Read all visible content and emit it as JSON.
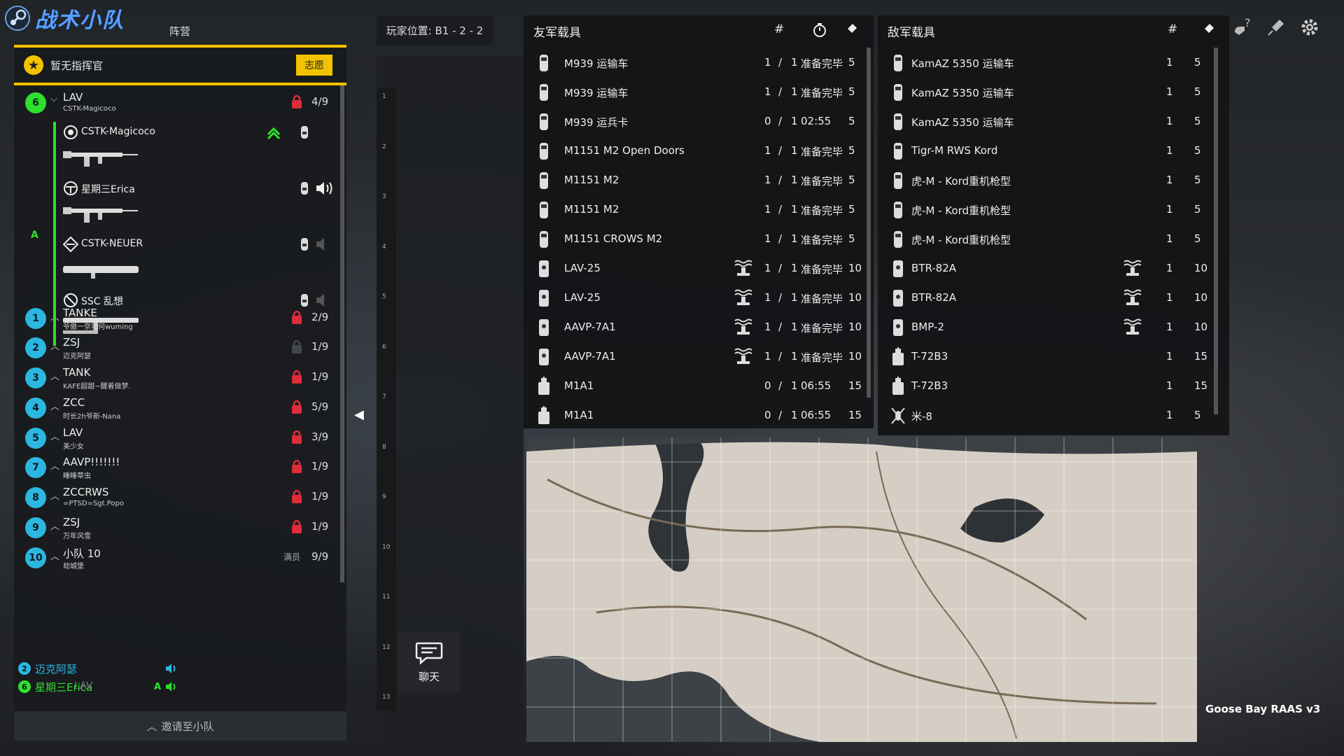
{
  "header": {
    "logo_text": "战术小队",
    "camp_label": "阵营",
    "player_location": "玩家位置: B1 - 2 - 2"
  },
  "commander": {
    "label": "暂无指挥官",
    "volunteer_button": "志愿"
  },
  "squads": [
    {
      "num": "6",
      "name": "LAV",
      "leader": "CSTK-Magicoco",
      "count": "4/9",
      "locked": true,
      "expanded": true,
      "color": "#2ee02e"
    },
    {
      "num": "1",
      "name": "TANKE",
      "leader": "爷傲一奈我何wuming",
      "count": "2/9",
      "locked": true
    },
    {
      "num": "2",
      "name": "ZSJ",
      "leader": "迈克阿瑟",
      "count": "1/9",
      "locked": false
    },
    {
      "num": "3",
      "name": "TANK",
      "leader": "KAFE超甜~醒着做梦.",
      "count": "1/9",
      "locked": true
    },
    {
      "num": "4",
      "name": "ZCC",
      "leader": "时长2h爷新-Nana",
      "count": "5/9",
      "locked": true
    },
    {
      "num": "5",
      "name": "LAV",
      "leader": "美少女",
      "count": "3/9",
      "locked": true
    },
    {
      "num": "7",
      "name": "AAVP!!!!!!!",
      "leader": "睡睡草虫",
      "count": "1/9",
      "locked": true
    },
    {
      "num": "8",
      "name": "ZCCRWS",
      "leader": "=PTSD=Sgt.Popo",
      "count": "1/9",
      "locked": true
    },
    {
      "num": "9",
      "name": "ZSJ",
      "leader": "万年风雪",
      "count": "1/9",
      "locked": true
    },
    {
      "num": "10",
      "name": "小队 10",
      "leader": "劫城堡",
      "count": "9/9",
      "full_label": "满员"
    }
  ],
  "members": [
    {
      "name": "CSTK-Magicoco"
    },
    {
      "name": "星期三Erica"
    },
    {
      "name": "CSTK-NEUER"
    },
    {
      "name": "SSC 乱想"
    }
  ],
  "fireteam_label": "A",
  "voice": [
    {
      "num": "2",
      "name": "迈克阿瑟",
      "color": "#2bb7e0"
    },
    {
      "num": "6",
      "name": "星期三Erica",
      "tag": "A",
      "color": "#2ee02e",
      "overlay": "LAV"
    }
  ],
  "invite_label": "邀请至小队",
  "chat_label": "聊天",
  "ruler": [
    "1",
    "2",
    "3",
    "4",
    "5",
    "6",
    "7",
    "8",
    "9",
    "10",
    "11",
    "12",
    "13"
  ],
  "friendly": {
    "title": "友军载具",
    "col_hash": "#",
    "rows": [
      {
        "name": "M939 运输车",
        "cur": "1",
        "max": "1",
        "status": "准备完毕",
        "tickets": "5",
        "ammo": false
      },
      {
        "name": "M939 运输车",
        "cur": "1",
        "max": "1",
        "status": "准备完毕",
        "tickets": "5",
        "ammo": false
      },
      {
        "name": "M939 运兵卡",
        "cur": "0",
        "max": "1",
        "status": "02:55",
        "tickets": "5",
        "ammo": false
      },
      {
        "name": "M1151 M2 Open Doors",
        "cur": "1",
        "max": "1",
        "status": "准备完毕",
        "tickets": "5",
        "ammo": false
      },
      {
        "name": "M1151 M2",
        "cur": "1",
        "max": "1",
        "status": "准备完毕",
        "tickets": "5",
        "ammo": false
      },
      {
        "name": "M1151 M2",
        "cur": "1",
        "max": "1",
        "status": "准备完毕",
        "tickets": "5",
        "ammo": false
      },
      {
        "name": "M1151 CROWS M2",
        "cur": "1",
        "max": "1",
        "status": "准备完毕",
        "tickets": "5",
        "ammo": false
      },
      {
        "name": "LAV-25",
        "cur": "1",
        "max": "1",
        "status": "准备完毕",
        "tickets": "10",
        "ammo": true
      },
      {
        "name": "LAV-25",
        "cur": "1",
        "max": "1",
        "status": "准备完毕",
        "tickets": "10",
        "ammo": true
      },
      {
        "name": "AAVP-7A1",
        "cur": "1",
        "max": "1",
        "status": "准备完毕",
        "tickets": "10",
        "ammo": true
      },
      {
        "name": "AAVP-7A1",
        "cur": "1",
        "max": "1",
        "status": "准备完毕",
        "tickets": "10",
        "ammo": true
      },
      {
        "name": "M1A1",
        "cur": "0",
        "max": "1",
        "status": "06:55",
        "tickets": "15",
        "ammo": false
      },
      {
        "name": "M1A1",
        "cur": "0",
        "max": "1",
        "status": "06:55",
        "tickets": "15",
        "ammo": false
      }
    ]
  },
  "enemy": {
    "title": "敌军载具",
    "col_hash": "#",
    "rows": [
      {
        "name": "KamAZ 5350 运输车",
        "count": "1",
        "tickets": "5",
        "ammo": false
      },
      {
        "name": "KamAZ 5350 运输车",
        "count": "1",
        "tickets": "5",
        "ammo": false
      },
      {
        "name": "KamAZ 5350 运输车",
        "count": "1",
        "tickets": "5",
        "ammo": false
      },
      {
        "name": "Tigr-M RWS Kord",
        "count": "1",
        "tickets": "5",
        "ammo": false
      },
      {
        "name": "虎-M - Kord重机枪型",
        "count": "1",
        "tickets": "5",
        "ammo": false
      },
      {
        "name": "虎-M - Kord重机枪型",
        "count": "1",
        "tickets": "5",
        "ammo": false
      },
      {
        "name": "虎-M - Kord重机枪型",
        "count": "1",
        "tickets": "5",
        "ammo": false
      },
      {
        "name": "BTR-82A",
        "count": "1",
        "tickets": "10",
        "ammo": true
      },
      {
        "name": "BTR-82A",
        "count": "1",
        "tickets": "10",
        "ammo": true
      },
      {
        "name": "BMP-2",
        "count": "1",
        "tickets": "10",
        "ammo": true
      },
      {
        "name": "T-72B3",
        "count": "1",
        "tickets": "15",
        "ammo": false
      },
      {
        "name": "T-72B3",
        "count": "1",
        "tickets": "15",
        "ammo": false
      },
      {
        "name": "米-8",
        "count": "1",
        "tickets": "5",
        "ammo": false
      }
    ]
  },
  "map_name": "Goose Bay RAAS v3",
  "top_right_icons": [
    "help-icon",
    "rocket-icon",
    "gear-icon"
  ]
}
